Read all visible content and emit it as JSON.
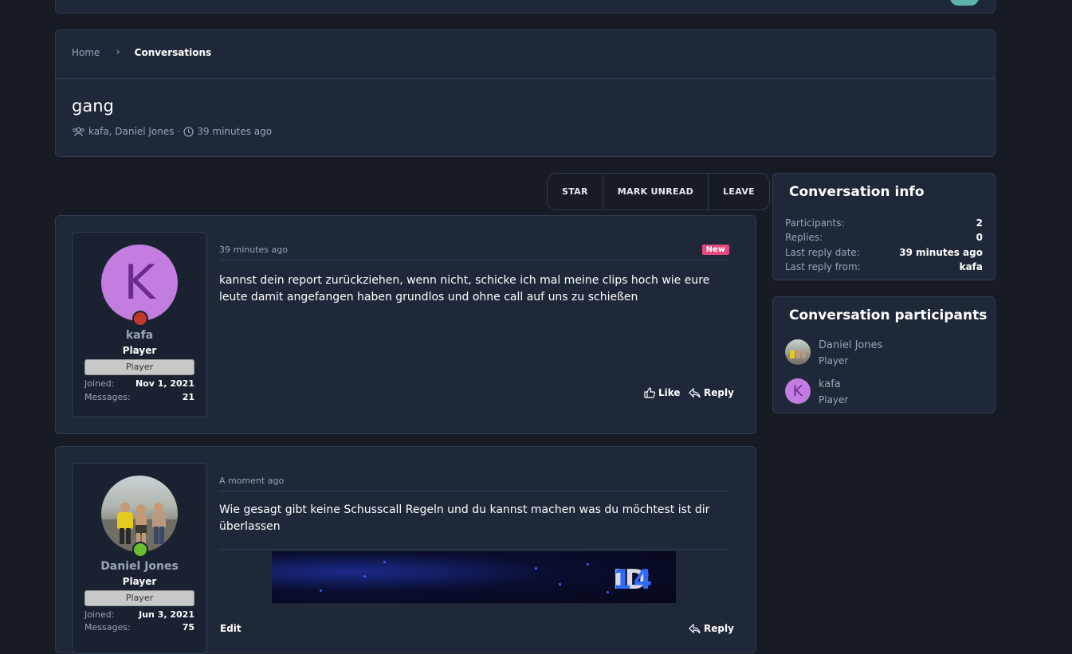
{
  "breadcrumb": {
    "home": "Home",
    "current": "Conversations"
  },
  "conversation": {
    "title": "gang",
    "participants_text": "kafa, Daniel Jones",
    "separator": "·",
    "time": "39 minutes ago"
  },
  "actions": {
    "star": "STAR",
    "mark_unread": "MARK UNREAD",
    "leave": "LEAVE"
  },
  "posts": [
    {
      "avatar_letter": "K",
      "username": "kafa",
      "user_title": "Player",
      "banner": "Player",
      "joined_label": "Joined:",
      "joined": "Nov 1, 2021",
      "messages_label": "Messages:",
      "messages": "21",
      "time": "39 minutes ago",
      "badge": "New",
      "body": "kannst dein report zurückziehen, wenn nicht, schicke ich mal meine clips hoch wie eure leute damit angefangen haben grundlos und ohne call auf uns zu schießen",
      "like": "Like",
      "reply": "Reply",
      "status_color": "#c0392b"
    },
    {
      "username": "Daniel Jones",
      "user_title": "Player",
      "banner": "Player",
      "joined_label": "Joined:",
      "joined": "Jun 3, 2021",
      "messages_label": "Messages:",
      "messages": "75",
      "time": "A moment ago",
      "body": "Wie gesagt gibt keine Schusscall Regeln und du kannst machen was du möchtest ist dir überlassen",
      "signature_text_a": "ID",
      "signature_text_b": "14",
      "edit": "Edit",
      "reply": "Reply",
      "status_color": "#6abf2e"
    }
  ],
  "sidebar": {
    "info_title": "Conversation info",
    "info": [
      {
        "label": "Participants:",
        "value": "2"
      },
      {
        "label": "Replies:",
        "value": "0"
      },
      {
        "label": "Last reply date:",
        "value": "39 minutes ago"
      },
      {
        "label": "Last reply from:",
        "value": "kafa"
      }
    ],
    "participants_title": "Conversation participants",
    "participants": [
      {
        "name": "Daniel Jones",
        "title": "Player"
      },
      {
        "name": "kafa",
        "title": "Player",
        "avatar_letter": "K"
      }
    ]
  },
  "colors": {
    "background": "#161b24",
    "panel": "#1f2838",
    "accent_new": "#e4497d",
    "avatar_purple": "#c37de1"
  }
}
